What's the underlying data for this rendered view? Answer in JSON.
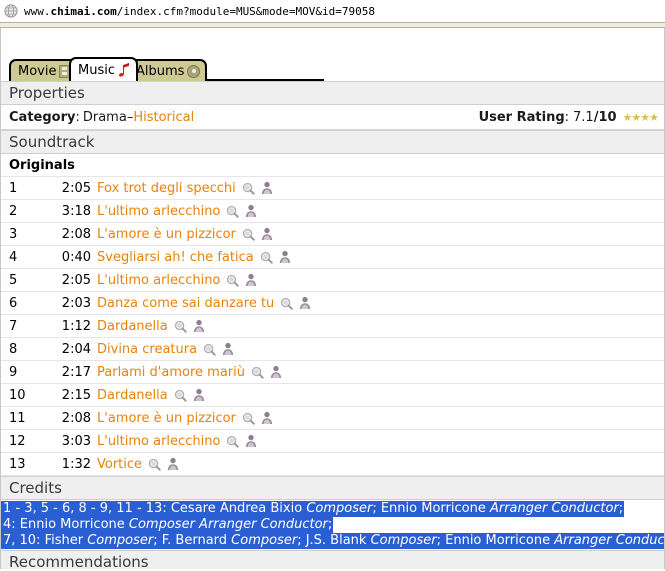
{
  "browser": {
    "globe_icon": "globe-icon",
    "url_prefix": "www.",
    "url_host": "chimai.com",
    "url_path": "/index.cfm?module=MUS&mode=MOV&id=79058",
    "url_full": "www.chimai.com/index.cfm?module=MUS&mode=MOV&id=79058"
  },
  "tabs": [
    {
      "label": "Movie",
      "icon": "film-strip-icon",
      "active": false
    },
    {
      "label": "Music",
      "icon": "music-note-icon",
      "active": true
    },
    {
      "label": "Albums",
      "icon": "compact-disc-icon",
      "active": false
    }
  ],
  "sections": {
    "properties": "Properties",
    "soundtrack": "Soundtrack",
    "credits": "Credits",
    "recommendations": "Recommendations"
  },
  "properties": {
    "category_label": "Category",
    "category_sep": ": ",
    "category_genre": "Drama",
    "category_dash": " – ",
    "category_subgenre": "Historical",
    "rating_label": "User Rating",
    "rating_sep": ": ",
    "rating_score": "7.1",
    "rating_max": "/10",
    "rating_stars": "★★★★",
    "rating_star_count": 4,
    "link_color": "#e8820c",
    "star_color": "#d6c254"
  },
  "soundtrack": {
    "group_title": "Originals",
    "row_icons": [
      "search-icon",
      "person-icon"
    ],
    "tracks": [
      {
        "num": "1",
        "duration": "2:05",
        "title": "Fox trot degli specchi"
      },
      {
        "num": "2",
        "duration": "3:18",
        "title": "L'ultimo arlecchino"
      },
      {
        "num": "3",
        "duration": "2:08",
        "title": "L'amore è un pizzicor"
      },
      {
        "num": "4",
        "duration": "0:40",
        "title": "Svegliarsi ah! che fatica"
      },
      {
        "num": "5",
        "duration": "2:05",
        "title": "L'ultimo arlecchino"
      },
      {
        "num": "6",
        "duration": "2:03",
        "title": "Danza come sai danzare tu"
      },
      {
        "num": "7",
        "duration": "1:12",
        "title": "Dardanella"
      },
      {
        "num": "8",
        "duration": "2:04",
        "title": "Divina creatura"
      },
      {
        "num": "9",
        "duration": "2:17",
        "title": "Parlami d'amore mariù"
      },
      {
        "num": "10",
        "duration": "2:15",
        "title": "Dardanella"
      },
      {
        "num": "11",
        "duration": "2:08",
        "title": "L'amore è un pizzicor"
      },
      {
        "num": "12",
        "duration": "3:03",
        "title": "L'ultimo arlecchino"
      },
      {
        "num": "13",
        "duration": "1:32",
        "title": "Vortice"
      }
    ]
  },
  "credits": {
    "selected": true,
    "selection_bg": "#2a5fd4",
    "selection_fg": "#ffffff",
    "lines": [
      {
        "tracks": "1 - 3, 5 - 6, 8 - 9, 11 - 13: ",
        "parts": [
          {
            "name": "Cesare Andrea Bixio ",
            "role": "Composer",
            "tail": "; "
          },
          {
            "name": "Ennio Morricone ",
            "role": "Arranger Conductor",
            "tail": ";"
          }
        ]
      },
      {
        "tracks": "4: ",
        "parts": [
          {
            "name": "Ennio Morricone ",
            "role": "Composer Arranger Conductor",
            "tail": ";"
          }
        ]
      },
      {
        "tracks": "7, 10:  ",
        "parts": [
          {
            "name": "Fisher ",
            "role": "Composer",
            "tail": "; "
          },
          {
            "name": "F. Bernard ",
            "role": "Composer",
            "tail": "; "
          },
          {
            "name": "J.S. Blank ",
            "role": "Composer",
            "tail": "; "
          },
          {
            "name": "Ennio Morricone ",
            "role": "Arranger Conductor",
            "tail": ";"
          }
        ]
      }
    ]
  }
}
